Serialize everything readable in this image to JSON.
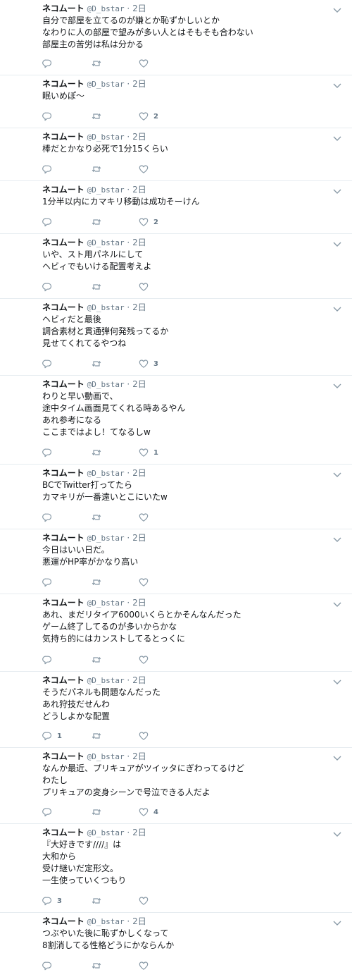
{
  "tweets": [
    {
      "name": "ネコムート",
      "handle": "@D_bstar",
      "time": "2日",
      "lines": [
        "自分で部屋を立てるのが嫌とか恥ずかしいとか",
        "なわりに人の部屋で望みが多い人とはそもそも合わない",
        "部屋主の苦労は私は分かる"
      ],
      "replies": "",
      "retweets": "",
      "likes": ""
    },
    {
      "name": "ネコムート",
      "handle": "@D_bstar",
      "time": "2日",
      "lines": [
        "眠いめぽ～"
      ],
      "replies": "",
      "retweets": "",
      "likes": "2"
    },
    {
      "name": "ネコムート",
      "handle": "@D_bstar",
      "time": "2日",
      "lines": [
        "棒だとかなり必死で1分15くらい"
      ],
      "replies": "",
      "retweets": "",
      "likes": ""
    },
    {
      "name": "ネコムート",
      "handle": "@D_bstar",
      "time": "2日",
      "lines": [
        "1分半以内にカマキリ移動は成功そーけん"
      ],
      "replies": "",
      "retweets": "",
      "likes": "2"
    },
    {
      "name": "ネコムート",
      "handle": "@D_bstar",
      "time": "2日",
      "lines": [
        "いや、スト用パネルにして",
        "ヘビィでもいける配置考えよ"
      ],
      "replies": "",
      "retweets": "",
      "likes": ""
    },
    {
      "name": "ネコムート",
      "handle": "@D_bstar",
      "time": "2日",
      "lines": [
        "ヘビィだと最後",
        "調合素材と貫通弾何発残ってるか",
        "見せてくれてるやつね"
      ],
      "replies": "",
      "retweets": "",
      "likes": "3"
    },
    {
      "name": "ネコムート",
      "handle": "@D_bstar",
      "time": "2日",
      "lines": [
        "わりと早い動画で、",
        "途中タイム画面見てくれる時あるやん",
        "あれ参考になる",
        "ここまではよし！てなるしw"
      ],
      "replies": "",
      "retweets": "",
      "likes": "1"
    },
    {
      "name": "ネコムート",
      "handle": "@D_bstar",
      "time": "2日",
      "lines": [
        "BCでTwitter打ってたら",
        "カマキリが一番遠いとこにいたw"
      ],
      "replies": "",
      "retweets": "",
      "likes": ""
    },
    {
      "name": "ネコムート",
      "handle": "@D_bstar",
      "time": "2日",
      "lines": [
        "今日はいい日だ。",
        "悪運がHP率がかなり高い"
      ],
      "replies": "",
      "retweets": "",
      "likes": ""
    },
    {
      "name": "ネコムート",
      "handle": "@D_bstar",
      "time": "2日",
      "lines": [
        "あれ、まだリタイア6000いくらとかそんなんだった",
        "ゲーム終了してるのが多いからかな",
        "気持ち的にはカンストしてるとっくに"
      ],
      "replies": "",
      "retweets": "",
      "likes": ""
    },
    {
      "name": "ネコムート",
      "handle": "@D_bstar",
      "time": "2日",
      "lines": [
        "そうだパネルも問題なんだった",
        "あれ狩技だせんわ",
        "どうしよかな配置"
      ],
      "replies": "1",
      "retweets": "",
      "likes": ""
    },
    {
      "name": "ネコムート",
      "handle": "@D_bstar",
      "time": "2日",
      "lines": [
        "なんか最近、プリキュアがツイッタにぎわってるけど",
        "わたし",
        "プリキュアの変身シーンで号泣できる人だよ"
      ],
      "replies": "",
      "retweets": "",
      "likes": "4"
    },
    {
      "name": "ネコムート",
      "handle": "@D_bstar",
      "time": "2日",
      "lines": [
        "『大好きです////』は",
        "大和から",
        "受け継いだ定形文。",
        "一生使っていくつもり"
      ],
      "replies": "3",
      "retweets": "",
      "likes": ""
    },
    {
      "name": "ネコムート",
      "handle": "@D_bstar",
      "time": "2日",
      "lines": [
        "つぶやいた後に恥ずかしくなって",
        "8割消してる性格どうにかならんか"
      ],
      "replies": "",
      "retweets": "",
      "likes": ""
    }
  ]
}
